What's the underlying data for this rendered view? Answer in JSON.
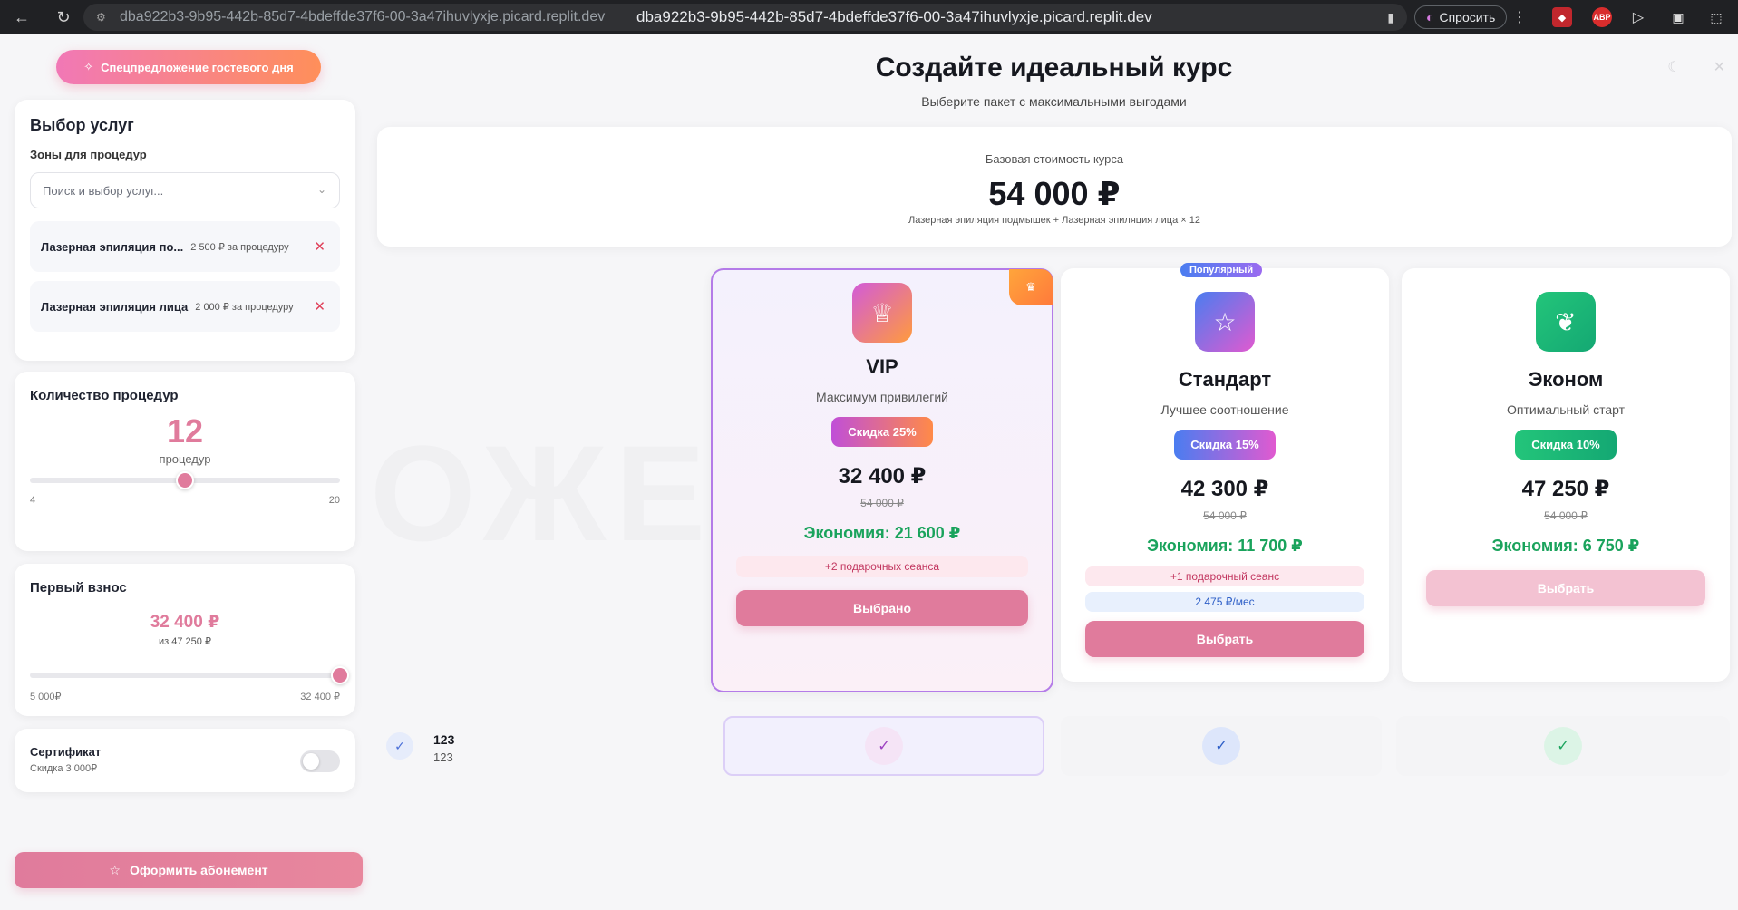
{
  "browser": {
    "url": "dba922b3-9b95-442b-85d7-4bdeffde37f6-00-3a47ihuvlyxje.picard.replit.dev",
    "ask_label": "Спросить",
    "ext_abp": "ABP"
  },
  "sidebar": {
    "promo_label": "Спецпредложение гостевого дня",
    "services": {
      "title": "Выбор услуг",
      "zones_label": "Зоны для процедур",
      "search_placeholder": "Поиск и выбор услуг...",
      "items": [
        {
          "name": "Лазерная эпиляция по...",
          "price": "2 500 ₽ за процедуру"
        },
        {
          "name": "Лазерная эпиляция лица",
          "price": "2 000 ₽ за процедуру"
        }
      ]
    },
    "count": {
      "title": "Количество процедур",
      "value": "12",
      "unit": "процедур",
      "min": "4",
      "max": "20",
      "fraction": 0.5
    },
    "down_payment": {
      "title": "Первый взнос",
      "amount": "32 400 ₽",
      "of": "из 47 250 ₽",
      "min": "5 000₽",
      "max": "32 400 ₽",
      "fraction": 1.0
    },
    "certificate": {
      "title": "Сертификат",
      "sub": "Скидка 3 000₽",
      "enabled": false
    },
    "subscribe_label": "Оформить абонемент"
  },
  "main": {
    "title": "Создайте идеальный курс",
    "subtitle": "Выберите пакет с максимальными выгодами",
    "base": {
      "label": "Базовая стоимость курса",
      "price": "54 000 ₽",
      "desc": "Лазерная эпиляция подмышек + Лазерная эпиляция лица × 12"
    },
    "plans": {
      "vip": {
        "name": "VIP",
        "tagline": "Максимум привилегий",
        "discount": "Скидка 25%",
        "price": "32 400 ₽",
        "old": "54 000 ₽",
        "save": "Экономия: 21 600 ₽",
        "gift": "+2 подарочных сеанса",
        "button": "Выбрано"
      },
      "std": {
        "badge": "Популярный",
        "name": "Стандарт",
        "tagline": "Лучшее соотношение",
        "discount": "Скидка 15%",
        "price": "42 300 ₽",
        "old": "54 000 ₽",
        "save": "Экономия: 11 700 ₽",
        "gift": "+1 подарочный сеанс",
        "monthly": "2 475 ₽/мес",
        "button": "Выбрать"
      },
      "eco": {
        "name": "Эконом",
        "tagline": "Оптимальный старт",
        "discount": "Скидка 10%",
        "price": "47 250 ₽",
        "old": "54 000 ₽",
        "save": "Экономия: 6 750 ₽",
        "button": "Выбрать"
      }
    },
    "feature": {
      "label": "123",
      "sub": "123"
    }
  }
}
